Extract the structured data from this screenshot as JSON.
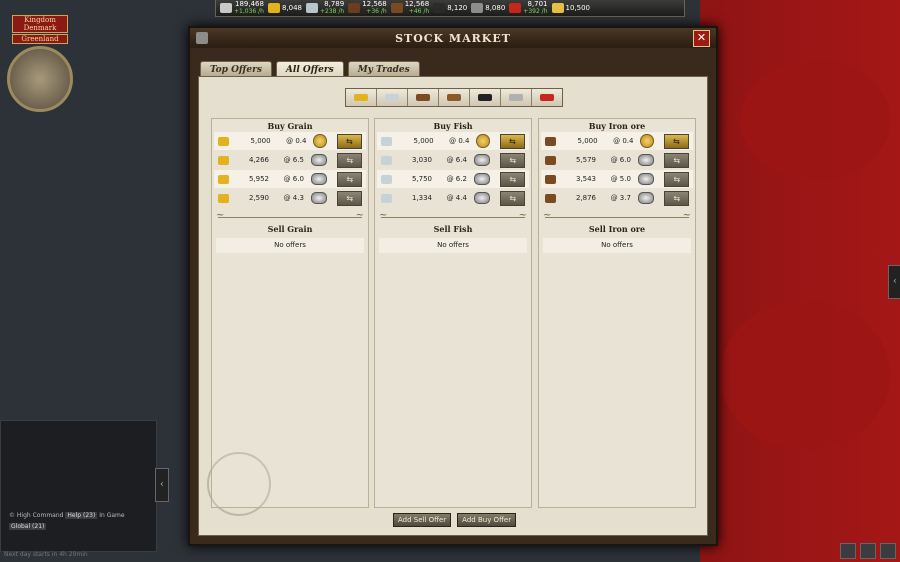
{
  "top_bar": {
    "resources": [
      {
        "icon": "coins-icon",
        "value": "189,468",
        "rate": "+1,036 /h",
        "color": "#c9c9c9"
      },
      {
        "icon": "grain-icon",
        "value": "8,048",
        "rate": "",
        "color": "#e3b21e"
      },
      {
        "icon": "fish-icon",
        "value": "8,789",
        "rate": "+238 /h",
        "color": "#b8c6cc"
      },
      {
        "icon": "iron-ore-icon",
        "value": "12,568",
        "rate": "+36 /h",
        "color": "#6b3f1e"
      },
      {
        "icon": "wood-icon",
        "value": "12,568",
        "rate": "+46 /h",
        "color": "#7a4a22"
      },
      {
        "icon": "coal-icon",
        "value": "8,120",
        "rate": "",
        "color": "#2b2b2b"
      },
      {
        "icon": "metal-icon",
        "value": "8,080",
        "rate": "",
        "color": "#8e8e8e"
      },
      {
        "icon": "oil-icon",
        "value": "8,701",
        "rate": "+392 /h",
        "color": "#c8261b"
      },
      {
        "icon": "gold-coin-icon",
        "value": "10,500",
        "rate": "",
        "color": "#e4c04a"
      }
    ]
  },
  "profile": {
    "label_top": "Kingdom Denmark",
    "label_region": "Greenland"
  },
  "chat": {
    "line1_prefix": "©",
    "high_command": "High Command",
    "help": "Help (23)",
    "in_game": "In Game",
    "global": "Global (21)"
  },
  "bottom_hint": "Next day starts in 4h 20min",
  "window": {
    "title": "STOCK MARKET",
    "close_symbol": "✕",
    "tabs": [
      {
        "label": "Top Offers",
        "active": false
      },
      {
        "label": "All Offers",
        "active": true
      },
      {
        "label": "My Trades",
        "active": false
      }
    ],
    "filters": [
      {
        "icon": "grain-icon",
        "color": "#e3b21e"
      },
      {
        "icon": "fish-icon",
        "color": "#c7d2d6"
      },
      {
        "icon": "iron-ore-icon",
        "color": "#7a4a22"
      },
      {
        "icon": "wood-icon",
        "color": "#8b5a2b"
      },
      {
        "icon": "coal-icon",
        "color": "#222222"
      },
      {
        "icon": "metal-icon",
        "color": "#b0b0b0"
      },
      {
        "icon": "oil-icon",
        "color": "#c8261b"
      }
    ],
    "columns": [
      {
        "buy_title": "Buy Grain",
        "sell_title": "Sell Grain",
        "icon_color": "#e3b21e",
        "no_offers": "No offers",
        "rows": [
          {
            "qty": "5,000",
            "price": "@ 0.4",
            "currency": "gold",
            "action": "gold"
          },
          {
            "qty": "4,266",
            "price": "@ 6.5",
            "currency": "silver",
            "action": "grey"
          },
          {
            "qty": "5,952",
            "price": "@ 6.0",
            "currency": "silver",
            "action": "grey"
          },
          {
            "qty": "2,590",
            "price": "@ 4.3",
            "currency": "silver",
            "action": "grey"
          }
        ]
      },
      {
        "buy_title": "Buy Fish",
        "sell_title": "Sell Fish",
        "icon_color": "#c7d2d6",
        "no_offers": "No offers",
        "rows": [
          {
            "qty": "5,000",
            "price": "@ 0.4",
            "currency": "gold",
            "action": "gold"
          },
          {
            "qty": "3,030",
            "price": "@ 6.4",
            "currency": "silver",
            "action": "grey"
          },
          {
            "qty": "5,750",
            "price": "@ 6.2",
            "currency": "silver",
            "action": "grey"
          },
          {
            "qty": "1,334",
            "price": "@ 4.4",
            "currency": "silver",
            "action": "grey"
          }
        ]
      },
      {
        "buy_title": "Buy Iron ore",
        "sell_title": "Sell Iron ore",
        "icon_color": "#7a4a22",
        "no_offers": "No offers",
        "rows": [
          {
            "qty": "5,000",
            "price": "@ 0.4",
            "currency": "gold",
            "action": "gold"
          },
          {
            "qty": "5,579",
            "price": "@ 6.0",
            "currency": "silver",
            "action": "grey"
          },
          {
            "qty": "3,543",
            "price": "@ 5.0",
            "currency": "silver",
            "action": "grey"
          },
          {
            "qty": "2,876",
            "price": "@ 3.7",
            "currency": "silver",
            "action": "grey"
          }
        ]
      }
    ],
    "add_sell_label": "Add Sell Offer",
    "add_buy_label": "Add Buy Offer"
  }
}
